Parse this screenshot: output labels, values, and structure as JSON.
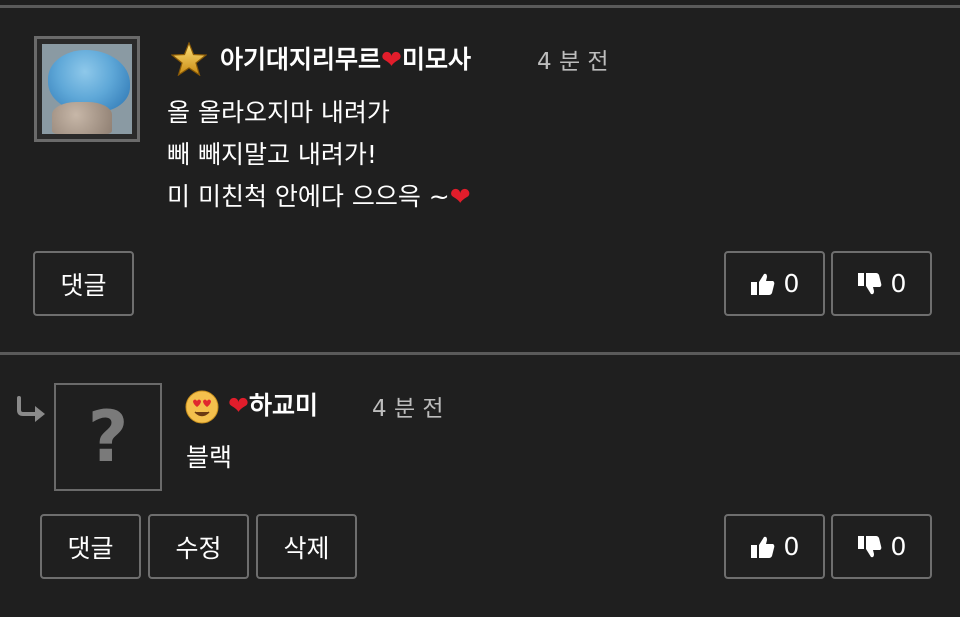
{
  "comment1": {
    "author": "아기대지리무르❤️미모사",
    "time": "4 분 전",
    "lines": [
      "올 올라오지마 내려가",
      "빼 빼지말고 내려가!",
      "미 미친척 안에다 으으윽 ~❤️"
    ],
    "reply_label": "댓글",
    "likes": "0",
    "dislikes": "0"
  },
  "comment2": {
    "author": "❤️하교미",
    "time": "4 분 전",
    "text": "블랙",
    "reply_label": "댓글",
    "edit_label": "수정",
    "delete_label": "삭제",
    "likes": "0",
    "dislikes": "0",
    "avatar_placeholder": "?"
  },
  "colors": {
    "background": "#1f1f1f",
    "heart": "#e11d2b",
    "border": "#6e6e6e",
    "muted_text": "#bdbdbd"
  },
  "icons": {
    "rank": "gold-star-icon",
    "reply_arrow": "reply-arrow-icon",
    "emoji": "heart-eyes-emoji-icon",
    "like": "thumbs-up-icon",
    "dislike": "thumbs-down-icon"
  }
}
